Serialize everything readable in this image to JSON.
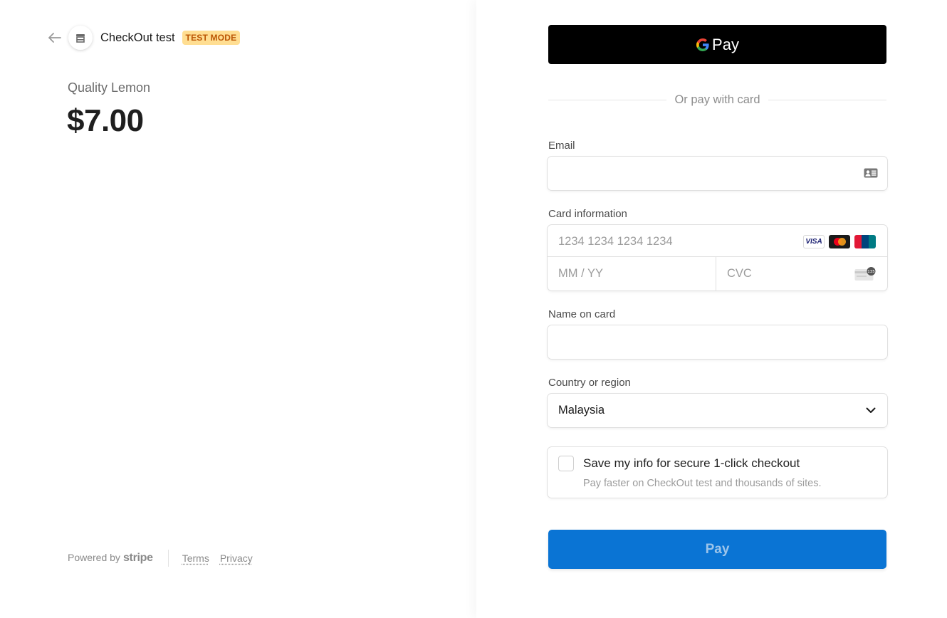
{
  "header": {
    "merchant_name": "CheckOut test",
    "badge": "TEST MODE"
  },
  "product": {
    "name": "Quality Lemon",
    "price": "$7.00"
  },
  "footer": {
    "powered_by": "Powered by",
    "brand": "stripe",
    "links": [
      "Terms",
      "Privacy"
    ]
  },
  "gpay": {
    "label": "Pay"
  },
  "divider_text": "Or pay with card",
  "form": {
    "email": {
      "label": "Email",
      "value": ""
    },
    "card": {
      "label": "Card information",
      "number_placeholder": "1234 1234 1234 1234",
      "expiry_placeholder": "MM / YY",
      "cvc_placeholder": "CVC",
      "brands": [
        "VISA",
        "mastercard",
        "UnionPay"
      ],
      "cvc_hint": "135"
    },
    "name": {
      "label": "Name on card",
      "value": ""
    },
    "country": {
      "label": "Country or region",
      "value": "Malaysia"
    },
    "save_info": {
      "title": "Save my info for secure 1-click checkout",
      "subtitle": "Pay faster on CheckOut test and thousands of sites.",
      "checked": false
    }
  },
  "pay_button": {
    "label": "Pay"
  },
  "colors": {
    "pay_button": "#0a74d4",
    "badge_bg": "#ffde92",
    "badge_text": "#bb5504"
  }
}
